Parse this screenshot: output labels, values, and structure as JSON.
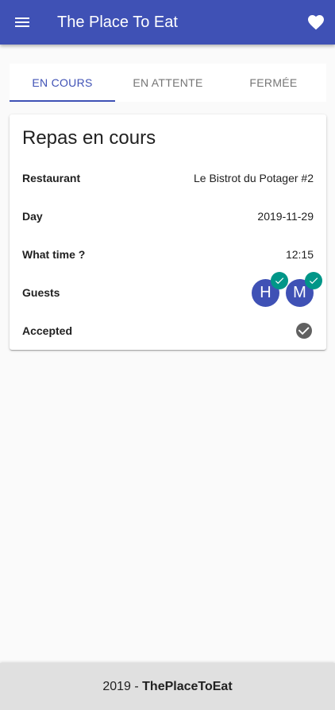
{
  "app": {
    "title": "The Place To Eat",
    "menu_icon": "menu-icon",
    "favorite_icon": "heart-icon",
    "primary_color": "#3f51b5"
  },
  "tabs": [
    {
      "label": "En cours",
      "active": true
    },
    {
      "label": "En attente",
      "active": false
    },
    {
      "label": "Fermée",
      "active": false
    }
  ],
  "card": {
    "title": "Repas en cours",
    "rows": {
      "restaurant": {
        "label": "Restaurant",
        "value": "Le Bistrot du Potager #2"
      },
      "day": {
        "label": "Day",
        "value": "2019-11-29"
      },
      "time": {
        "label": "What time ?",
        "value": "12:15"
      },
      "guests": {
        "label": "Guests",
        "list": [
          {
            "initial": "H",
            "confirmed": true
          },
          {
            "initial": "M",
            "confirmed": true
          }
        ]
      },
      "accepted": {
        "label": "Accepted",
        "icon": "check-circle-icon"
      }
    }
  },
  "footer": {
    "year_prefix": "2019 - ",
    "brand": "ThePlaceToEat"
  },
  "colors": {
    "badge": "#009688",
    "accepted_icon": "#616161"
  }
}
